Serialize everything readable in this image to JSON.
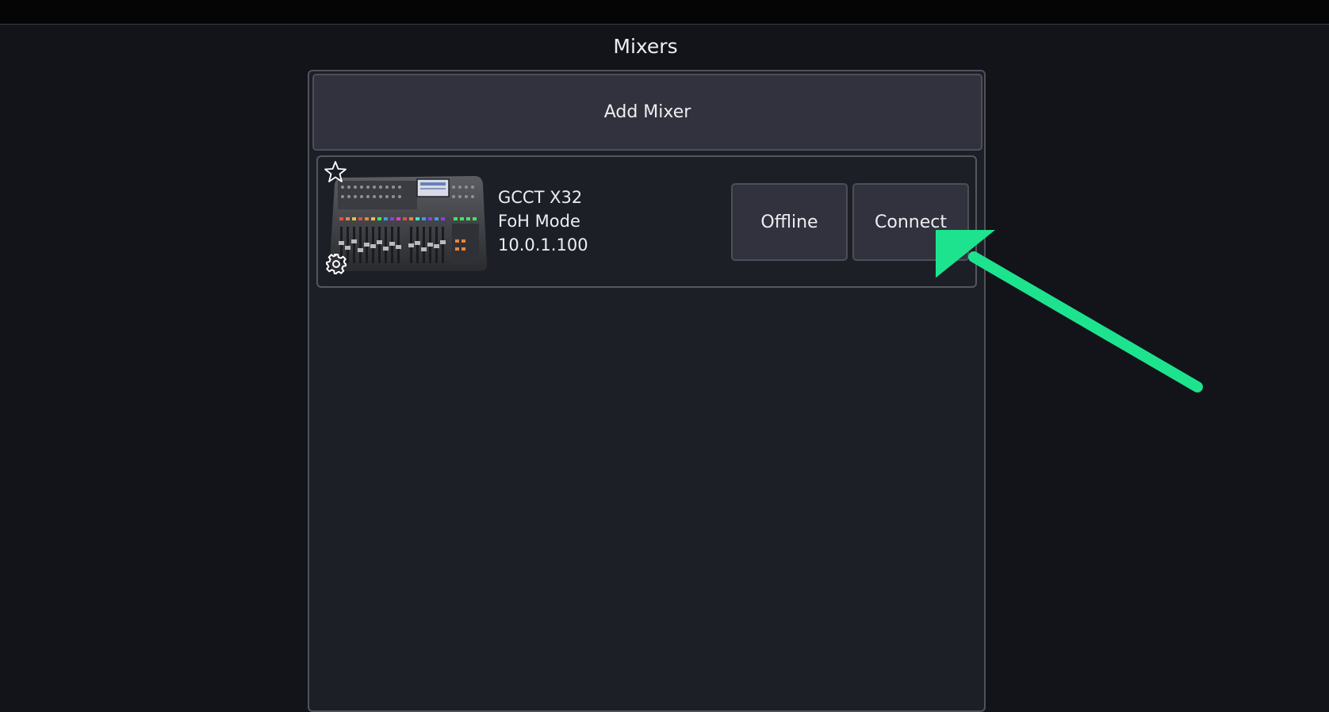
{
  "page": {
    "title": "Mixers"
  },
  "add_button": {
    "label": "Add Mixer"
  },
  "mixers": [
    {
      "name": "GCCT X32",
      "mode": "FoH Mode",
      "ip": "10.0.1.100",
      "status_label": "Offline",
      "connect_label": "Connect",
      "favorite_icon": "star-outline-icon",
      "settings_icon": "gear-icon"
    }
  ],
  "colors": {
    "background": "#131419",
    "panel": "#1d1f27",
    "button": "#31323d",
    "annotation_arrow": "#1de38f"
  }
}
